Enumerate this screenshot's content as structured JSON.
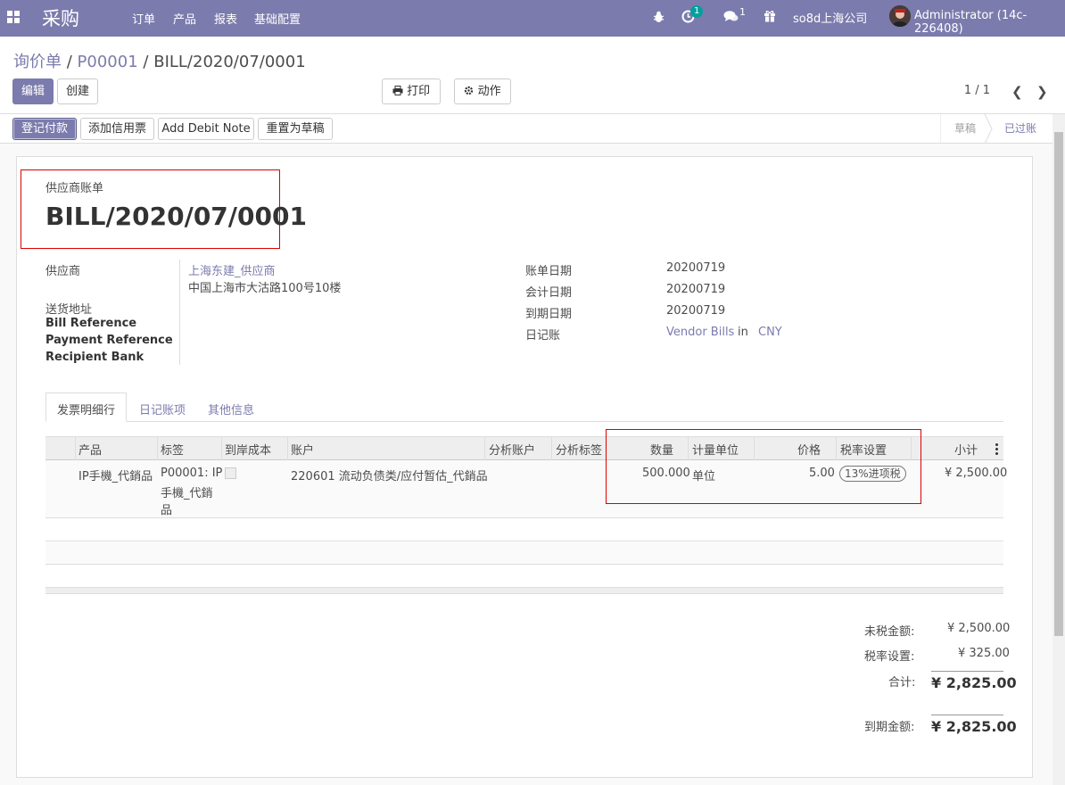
{
  "navbar": {
    "app_title": "采购",
    "menu": [
      "订单",
      "产品",
      "报表",
      "基础配置"
    ],
    "activity_count": "1",
    "messages_count": "1",
    "company": "so8d上海公司",
    "user": "Administrator (14c-226408)"
  },
  "breadcrumb": {
    "root": "询价单",
    "parent": "P00001",
    "current": "BILL/2020/07/0001",
    "sep": "/"
  },
  "toolbar": {
    "edit": "编辑",
    "create": "创建",
    "print": "打印",
    "action": "动作",
    "pager": "1 / 1"
  },
  "statusbar": {
    "buttons": [
      "登记付款",
      "添加信用票",
      "Add Debit Note",
      "重置为草稿"
    ],
    "stages": [
      "草稿",
      "已过账"
    ]
  },
  "form": {
    "doc_type": "供应商账单",
    "doc_name": "BILL/2020/07/0001",
    "vendor_label": "供应商",
    "vendor_name": "上海东建_供应商",
    "vendor_address": "中国上海市大沽路100号10楼",
    "delivery_label": "送货地址",
    "bill_ref_label": "Bill Reference",
    "payment_ref_label": "Payment Reference",
    "recipient_bank_label": "Recipient Bank",
    "bill_date_label": "账单日期",
    "bill_date": "20200719",
    "accounting_date_label": "会计日期",
    "accounting_date": "20200719",
    "due_date_label": "到期日期",
    "due_date": "20200719",
    "journal_label": "日记账",
    "journal": "Vendor Bills",
    "journal_in": "in",
    "currency": "CNY"
  },
  "tabs": [
    "发票明细行",
    "日记账项",
    "其他信息"
  ],
  "lines": {
    "columns": [
      "产品",
      "标签",
      "到岸成本",
      "账户",
      "分析账户",
      "分析标签",
      "数量",
      "计量单位",
      "价格",
      "税率设置",
      "小计"
    ],
    "rows": [
      {
        "product": "IP手機_代銷品",
        "label_line1": "P00001: IP",
        "label_line2": "手機_代銷",
        "label_line3": "品",
        "account": "220601 流动负债类/应付暂估_代銷品",
        "quantity": "500.000",
        "uom": "单位",
        "price": "5.00",
        "tax": "13%进项税",
        "subtotal": "¥ 2,500.00"
      }
    ]
  },
  "totals": {
    "untaxed_label": "未税金额:",
    "untaxed": "¥ 2,500.00",
    "tax_label": "税率设置:",
    "tax": "¥ 325.00",
    "total_label": "合计:",
    "total": "¥ 2,825.00",
    "due_label": "到期金额:",
    "due": "¥ 2,825.00"
  }
}
